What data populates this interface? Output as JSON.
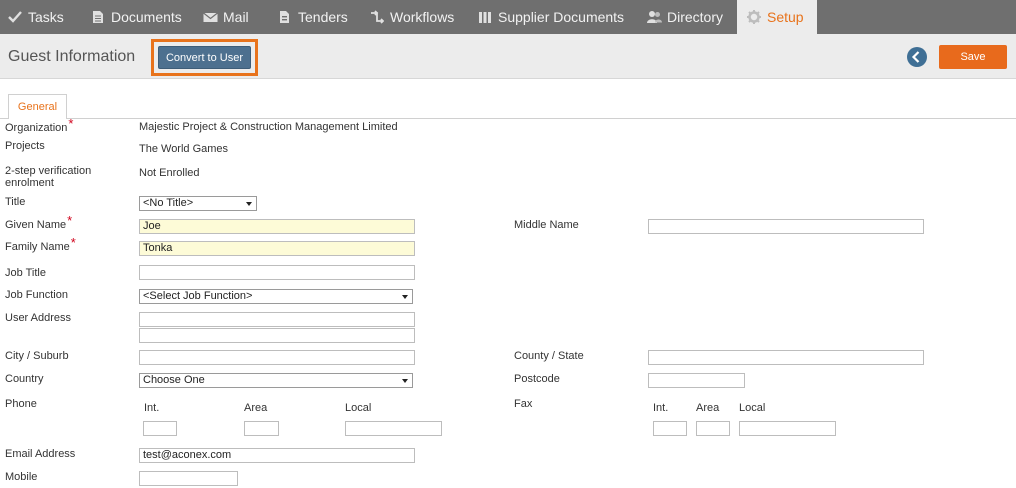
{
  "nav": {
    "items": [
      {
        "label": "Tasks",
        "icon": "check-icon"
      },
      {
        "label": "Documents",
        "icon": "document-icon"
      },
      {
        "label": "Mail",
        "icon": "mail-icon"
      },
      {
        "label": "Tenders",
        "icon": "tenders-icon"
      },
      {
        "label": "Workflows",
        "icon": "workflow-icon"
      },
      {
        "label": "Supplier Documents",
        "icon": "supplier-icon"
      },
      {
        "label": "Directory",
        "icon": "people-icon"
      },
      {
        "label": "Setup",
        "icon": "gear-icon",
        "active": true
      }
    ]
  },
  "header": {
    "title": "Guest Information",
    "convert_label": "Convert to User",
    "save_label": "Save"
  },
  "tabs": {
    "general": "General"
  },
  "form": {
    "organization": {
      "label": "Organization",
      "value": "Majestic Project & Construction Management Limited"
    },
    "projects": {
      "label": "Projects",
      "value": "The World Games"
    },
    "two_step": {
      "label_line1": "2-step verification",
      "label_line2": "enrolment",
      "value": "Not Enrolled"
    },
    "title": {
      "label": "Title",
      "value": "<No Title>"
    },
    "given_name": {
      "label": "Given Name",
      "value": "Joe"
    },
    "middle_name": {
      "label": "Middle Name",
      "value": ""
    },
    "family_name": {
      "label": "Family Name",
      "value": "Tonka"
    },
    "job_title": {
      "label": "Job Title",
      "value": ""
    },
    "job_function": {
      "label": "Job Function",
      "value": "<Select Job Function>"
    },
    "user_address": {
      "label": "User Address",
      "line1": "",
      "line2": ""
    },
    "city": {
      "label": "City / Suburb",
      "value": ""
    },
    "county": {
      "label": "County / State",
      "value": ""
    },
    "country": {
      "label": "Country",
      "value": "Choose One"
    },
    "postcode": {
      "label": "Postcode",
      "value": ""
    },
    "phone": {
      "label": "Phone",
      "int_label": "Int.",
      "area_label": "Area",
      "local_label": "Local"
    },
    "fax": {
      "label": "Fax",
      "int_label": "Int.",
      "area_label": "Area",
      "local_label": "Local"
    },
    "email": {
      "label": "Email Address",
      "value": "test@aconex.com"
    },
    "mobile": {
      "label": "Mobile",
      "value": ""
    }
  },
  "colors": {
    "accent": "#e8731c",
    "nav_bg": "#6f6f6f",
    "primary_button": "#4d708f",
    "required": "#d0021b"
  }
}
